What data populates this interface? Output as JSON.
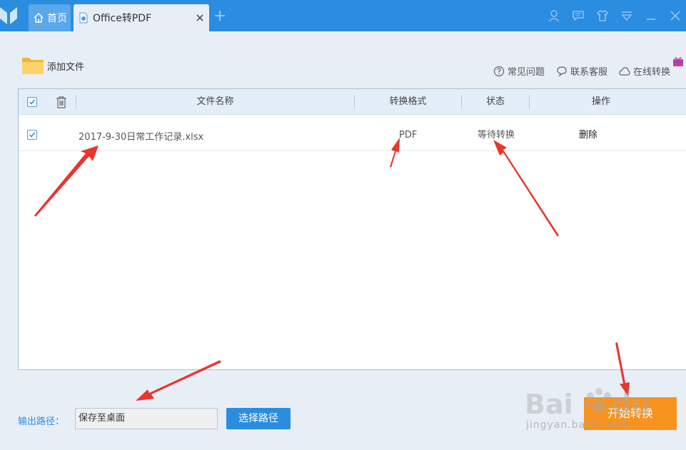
{
  "tabs": {
    "home_label": "首页",
    "active_label": "Office转PDF"
  },
  "toolbar": {
    "add_file_label": "添加文件",
    "links": [
      "常见问题",
      "联系客服",
      "在线转换"
    ]
  },
  "table": {
    "headers": [
      "文件名称",
      "转换格式",
      "状态",
      "操作"
    ],
    "rows": [
      {
        "checked": true,
        "file_name": "2017-9-30日常工作记录.xlsx",
        "format": "PDF",
        "status": "等待转换",
        "action": "删除"
      }
    ]
  },
  "output": {
    "label": "输出路径：",
    "path_value": "保存至桌面",
    "choose_label": "选择路径"
  },
  "start_label": "开始转换",
  "watermark": {
    "url": "jingyan.baidu.com"
  },
  "colors": {
    "titlebar": "#2b8de0",
    "accent": "#2b8de0",
    "start": "#f7931e",
    "arrow": "#e8362d"
  }
}
